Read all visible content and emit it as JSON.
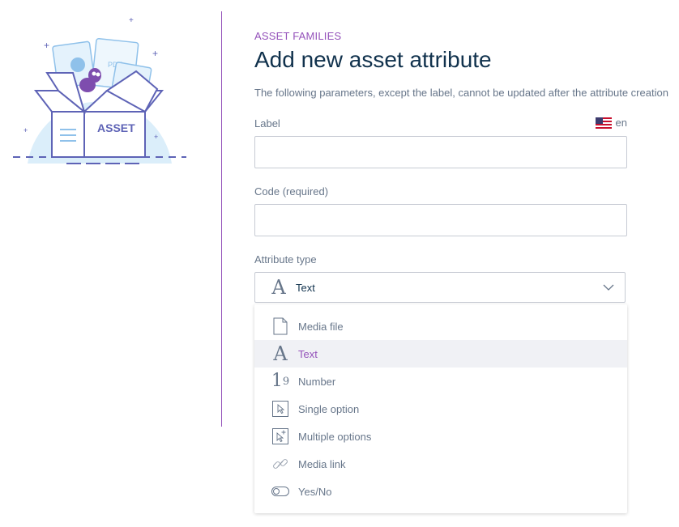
{
  "header": {
    "breadcrumb": "ASSET FAMILIES",
    "title": "Add new asset attribute",
    "helper": "The following parameters, except the label, cannot be updated after the attribute creation"
  },
  "illustration": {
    "box_label": "ASSET",
    "pdf_label": "PDF"
  },
  "form": {
    "label_field": {
      "label": "Label",
      "value": ""
    },
    "locale": {
      "code": "en",
      "flag": "us-flag-icon"
    },
    "code_field": {
      "label": "Code (required)",
      "value": ""
    },
    "attribute_type": {
      "label": "Attribute type",
      "selected": "Text"
    }
  },
  "dropdown": {
    "options": [
      {
        "label": "Media file",
        "icon": "media-file-icon"
      },
      {
        "label": "Text",
        "icon": "text-icon",
        "selected": true
      },
      {
        "label": "Number",
        "icon": "number-icon"
      },
      {
        "label": "Single option",
        "icon": "single-option-icon"
      },
      {
        "label": "Multiple options",
        "icon": "multiple-options-icon"
      },
      {
        "label": "Media link",
        "icon": "media-link-icon"
      },
      {
        "label": "Yes/No",
        "icon": "yes-no-icon"
      }
    ]
  },
  "colors": {
    "accent": "#9452ba",
    "title": "#11324d",
    "text": "#67768a",
    "border": "#c7cbd4",
    "highlight": "#f0f1f5"
  }
}
